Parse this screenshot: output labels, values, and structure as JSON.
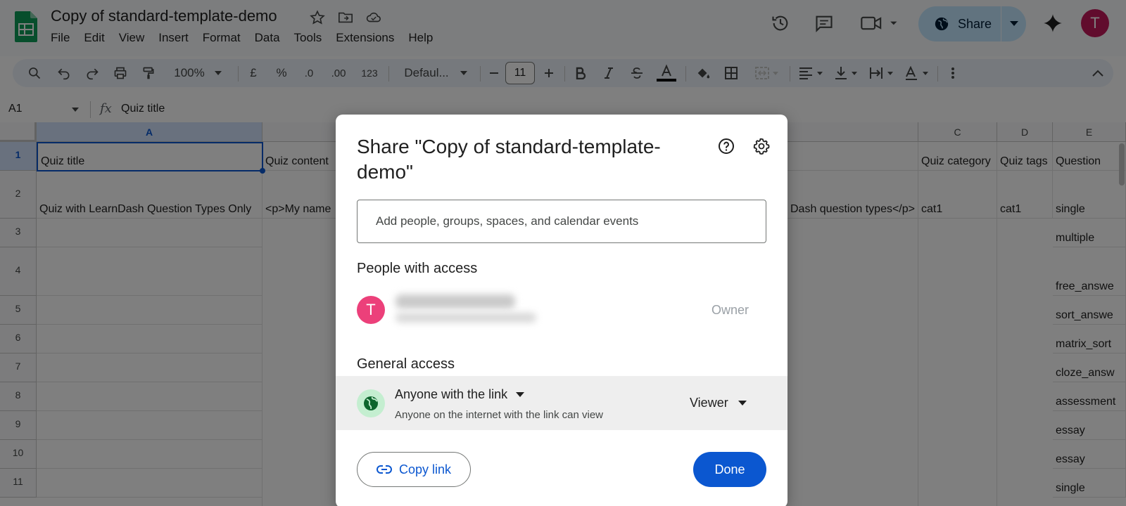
{
  "header": {
    "doc_title": "Copy of standard-template-demo",
    "menu": [
      "File",
      "Edit",
      "View",
      "Insert",
      "Format",
      "Data",
      "Tools",
      "Extensions",
      "Help"
    ],
    "share_label": "Share",
    "avatar_initial": "T",
    "colors": {
      "share_bg": "#c2e7ff",
      "avatar_bg": "#c2185b",
      "sheets_green": "#0f9d58"
    }
  },
  "toolbar": {
    "zoom": "100%",
    "currency": "£",
    "percent": "%",
    "dec_decrease": ".0",
    "dec_increase": ".00",
    "number_format": "123",
    "font_name": "Defaul...",
    "font_size": "11"
  },
  "formula_bar": {
    "cell_ref": "A1",
    "fx": "fx",
    "content": "Quiz title"
  },
  "grid": {
    "columns": [
      "A",
      "",
      "C",
      "D",
      "E"
    ],
    "rows": [
      "1",
      "2",
      "3",
      "4",
      "5",
      "6",
      "7",
      "8",
      "9",
      "10",
      "11"
    ],
    "col_a": [
      "Quiz title",
      "Quiz with LearnDash Question Types Only"
    ],
    "col_b": [
      "Quiz content",
      "<p>My name"
    ],
    "col_b_tail": [
      "",
      "Dash question types</p>"
    ],
    "col_c": [
      "Quiz category",
      "cat1"
    ],
    "col_d": [
      "Quiz tags",
      "cat1"
    ],
    "col_e": [
      "Question",
      "single",
      "multiple",
      "free_answe",
      "sort_answe",
      "matrix_sort",
      "cloze_answ",
      "assessment",
      "essay",
      "essay",
      "single"
    ]
  },
  "dialog": {
    "title": "Share \"Copy of standard-template-demo\"",
    "add_placeholder": "Add people, groups, spaces, and calendar events",
    "people_heading": "People with access",
    "person_initial": "T",
    "person_role": "Owner",
    "general_heading": "General access",
    "access_level": "Anyone with the link",
    "access_desc": "Anyone on the internet with the link can view",
    "role": "Viewer",
    "copy_link_label": "Copy link",
    "done_label": "Done",
    "colors": {
      "primary": "#0b57d0",
      "person_avatar": "#ec407a",
      "globe_bg": "#c4eed0"
    }
  }
}
